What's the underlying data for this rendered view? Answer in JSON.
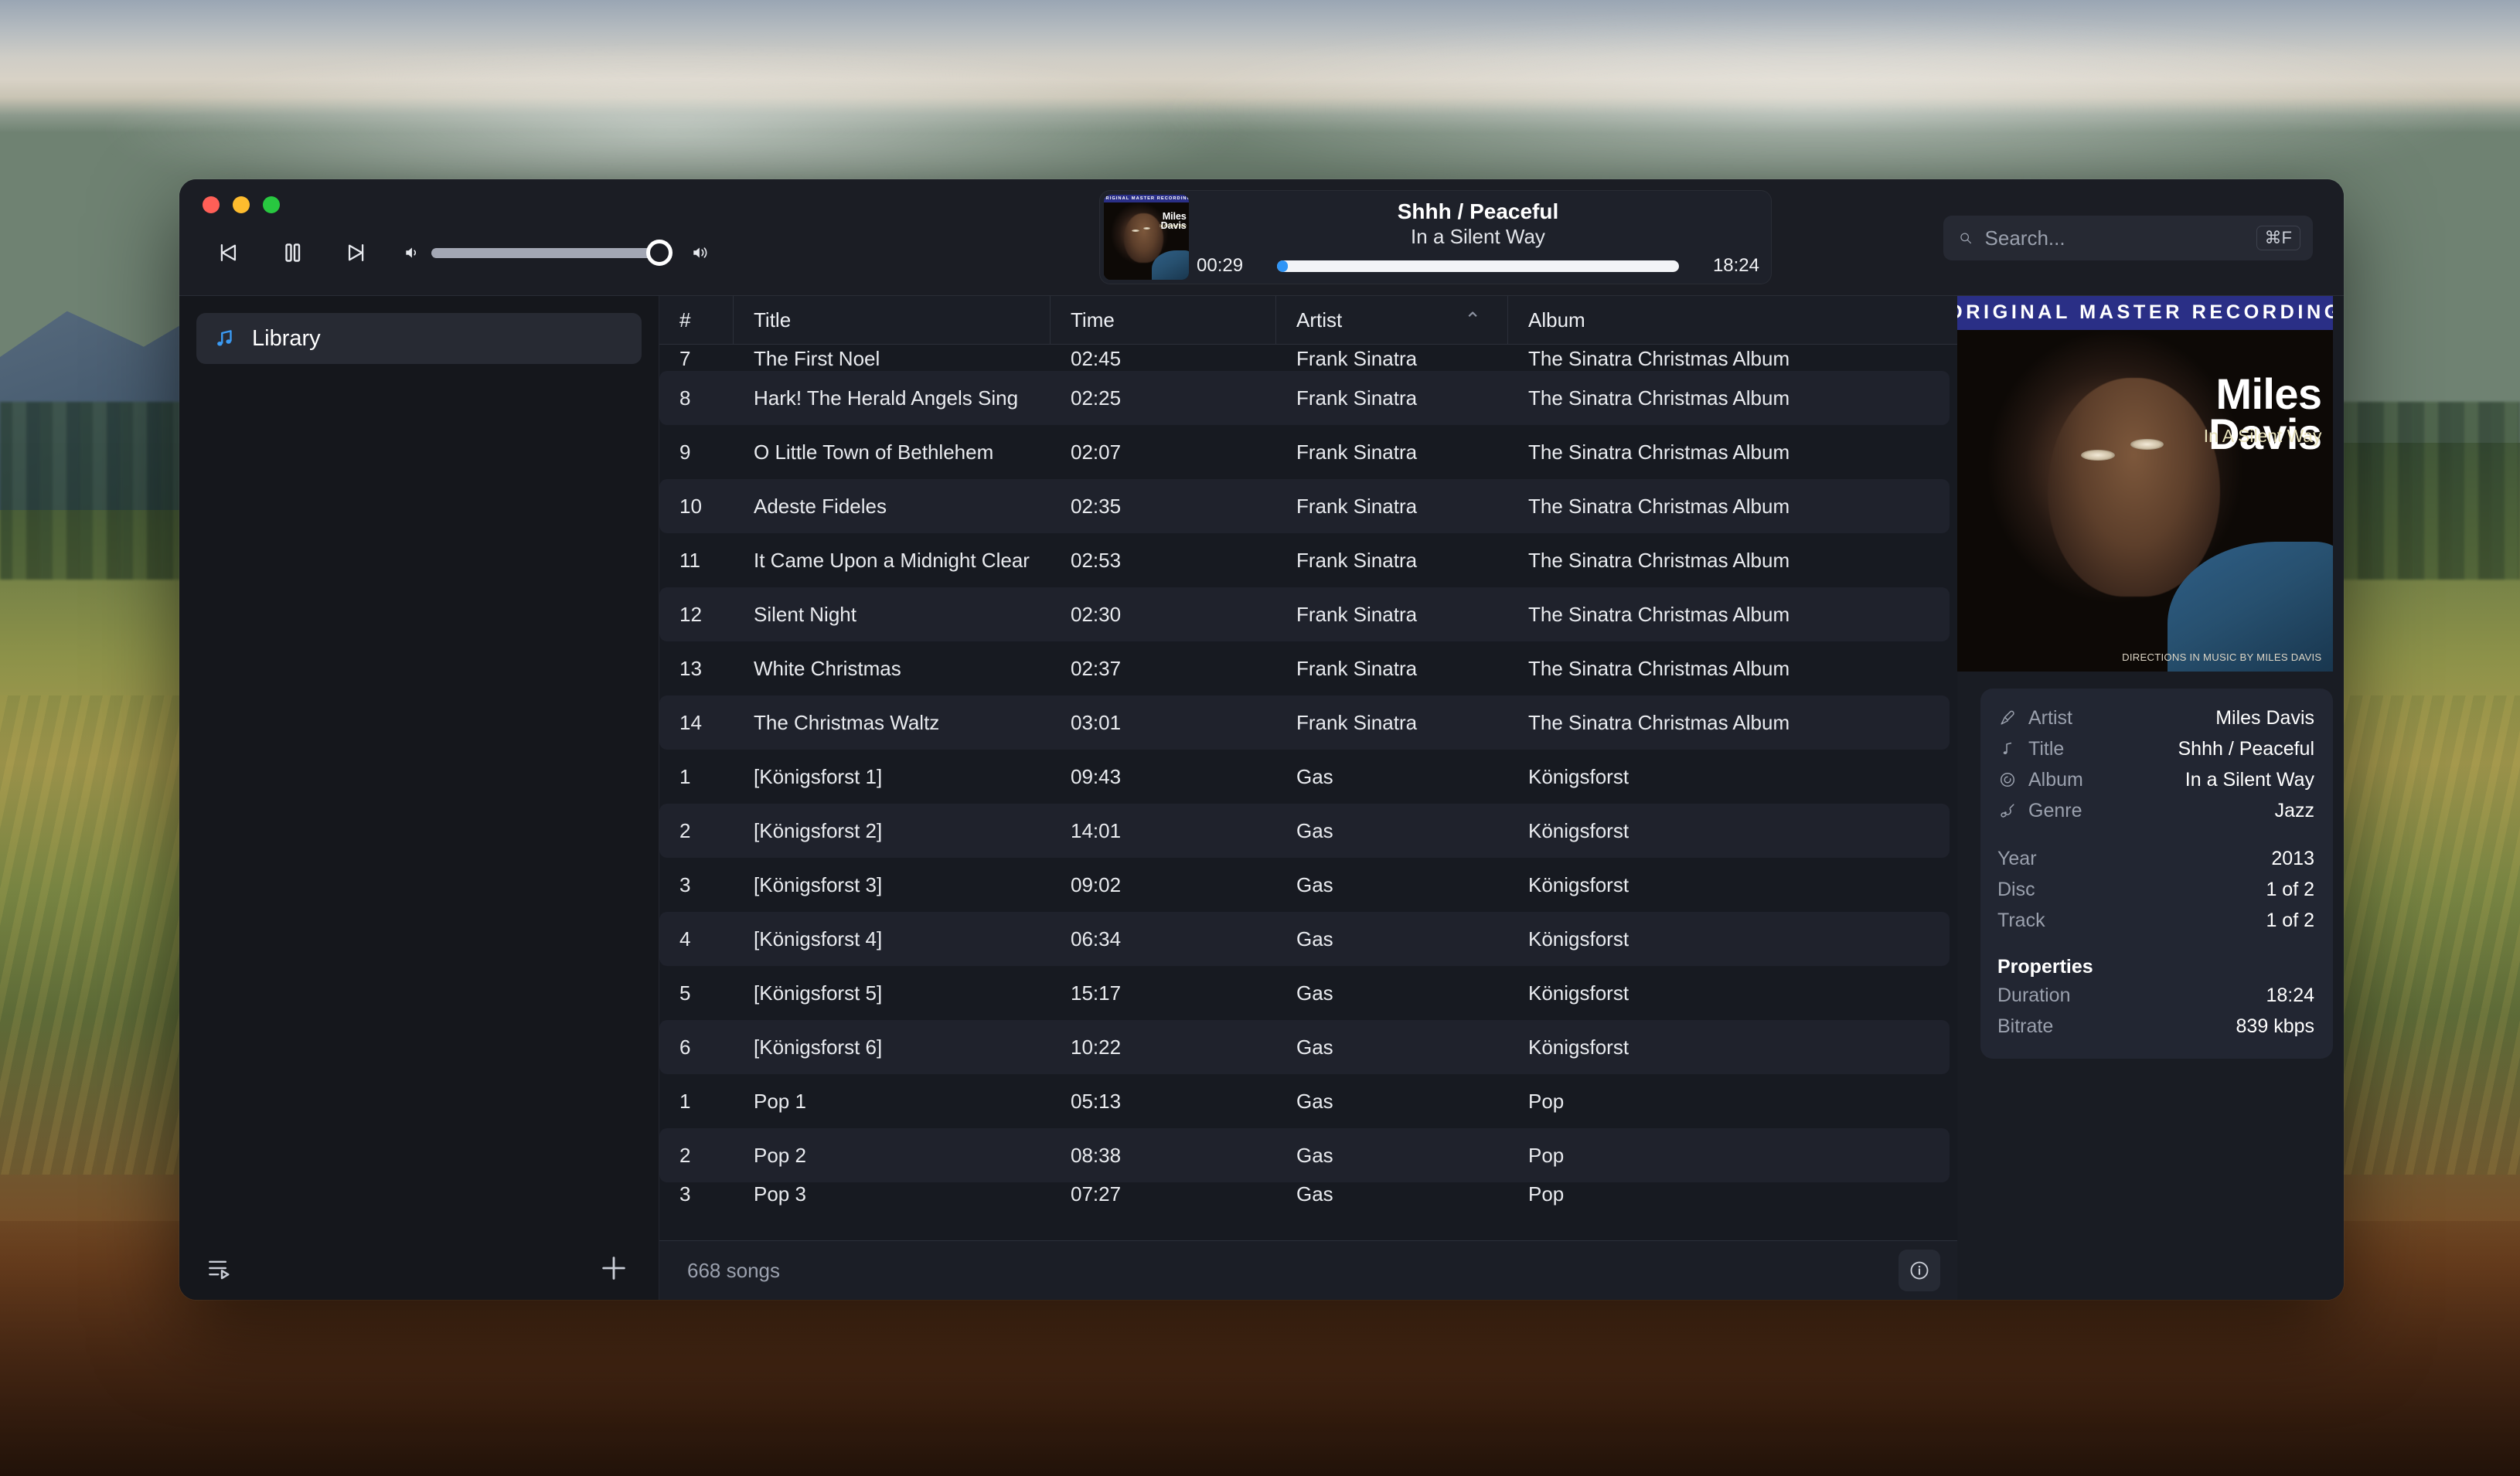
{
  "window": {
    "traffic_lights": [
      "close",
      "minimize",
      "maximize"
    ]
  },
  "player": {
    "previous_label": "Previous",
    "pause_label": "Pause",
    "next_label": "Next",
    "volume_percent": 100,
    "now_playing": {
      "title": "Shhh / Peaceful",
      "album": "In a Silent Way",
      "elapsed": "00:29",
      "remaining": "18:24",
      "progress_percent": 2.7
    }
  },
  "search": {
    "placeholder": "Search...",
    "value": "",
    "shortcut": "⌘F"
  },
  "album_art": {
    "banner": "ORIGINAL MASTER RECORDING",
    "artist_line1": "Miles",
    "artist_line2": "Davis",
    "album_title": "In A Silent Way",
    "credit": "DIRECTIONS IN MUSIC BY MILES DAVIS"
  },
  "sidebar": {
    "items": [
      {
        "label": "Library",
        "icon": "music-note-icon",
        "selected": true
      }
    ],
    "footer": {
      "queue_icon": "playlist-queue-icon",
      "add_icon": "plus-icon"
    }
  },
  "table": {
    "columns": [
      {
        "key": "num",
        "label": "#",
        "sorted": false
      },
      {
        "key": "title",
        "label": "Title",
        "sorted": false
      },
      {
        "key": "time",
        "label": "Time",
        "sorted": false
      },
      {
        "key": "artist",
        "label": "Artist",
        "sorted": true,
        "sort_direction": "ascending",
        "sort_glyph": "⌃"
      },
      {
        "key": "album",
        "label": "Album",
        "sorted": false
      }
    ],
    "rows": [
      {
        "num": "7",
        "title": "The First Noel",
        "time": "02:45",
        "artist": "Frank Sinatra",
        "album": "The Sinatra Christmas Album"
      },
      {
        "num": "8",
        "title": "Hark! The Herald Angels Sing",
        "time": "02:25",
        "artist": "Frank Sinatra",
        "album": "The Sinatra Christmas Album"
      },
      {
        "num": "9",
        "title": "O Little Town of Bethlehem",
        "time": "02:07",
        "artist": "Frank Sinatra",
        "album": "The Sinatra Christmas Album"
      },
      {
        "num": "10",
        "title": "Adeste Fideles",
        "time": "02:35",
        "artist": "Frank Sinatra",
        "album": "The Sinatra Christmas Album"
      },
      {
        "num": "11",
        "title": "It Came Upon a Midnight Clear",
        "time": "02:53",
        "artist": "Frank Sinatra",
        "album": "The Sinatra Christmas Album"
      },
      {
        "num": "12",
        "title": "Silent Night",
        "time": "02:30",
        "artist": "Frank Sinatra",
        "album": "The Sinatra Christmas Album"
      },
      {
        "num": "13",
        "title": "White Christmas",
        "time": "02:37",
        "artist": "Frank Sinatra",
        "album": "The Sinatra Christmas Album"
      },
      {
        "num": "14",
        "title": "The Christmas Waltz",
        "time": "03:01",
        "artist": "Frank Sinatra",
        "album": "The Sinatra Christmas Album"
      },
      {
        "num": "1",
        "title": "[Königsforst 1]",
        "time": "09:43",
        "artist": "Gas",
        "album": "Königsforst"
      },
      {
        "num": "2",
        "title": "[Königsforst 2]",
        "time": "14:01",
        "artist": "Gas",
        "album": "Königsforst"
      },
      {
        "num": "3",
        "title": "[Königsforst 3]",
        "time": "09:02",
        "artist": "Gas",
        "album": "Königsforst"
      },
      {
        "num": "4",
        "title": "[Königsforst 4]",
        "time": "06:34",
        "artist": "Gas",
        "album": "Königsforst"
      },
      {
        "num": "5",
        "title": "[Königsforst 5]",
        "time": "15:17",
        "artist": "Gas",
        "album": "Königsforst"
      },
      {
        "num": "6",
        "title": "[Königsforst 6]",
        "time": "10:22",
        "artist": "Gas",
        "album": "Königsforst"
      },
      {
        "num": "1",
        "title": "Pop 1",
        "time": "05:13",
        "artist": "Gas",
        "album": "Pop"
      },
      {
        "num": "2",
        "title": "Pop 2",
        "time": "08:38",
        "artist": "Gas",
        "album": "Pop"
      },
      {
        "num": "3",
        "title": "Pop 3",
        "time": "07:27",
        "artist": "Gas",
        "album": "Pop"
      }
    ]
  },
  "status": {
    "song_count": "668 songs",
    "info_icon": "info-circle-icon"
  },
  "info_panel": {
    "tags": [
      {
        "icon": "microphone-icon",
        "label": "Artist",
        "value": "Miles Davis"
      },
      {
        "icon": "music-note-icon",
        "label": "Title",
        "value": "Shhh / Peaceful"
      },
      {
        "icon": "disc-icon",
        "label": "Album",
        "value": "In a Silent Way"
      },
      {
        "icon": "guitar-icon",
        "label": "Genre",
        "value": "Jazz"
      }
    ],
    "numbers": [
      {
        "label": "Year",
        "value": "2013"
      },
      {
        "label": "Disc",
        "value": "1 of 2"
      },
      {
        "label": "Track",
        "value": "1 of 2"
      }
    ],
    "properties_heading": "Properties",
    "properties": [
      {
        "label": "Duration",
        "value": "18:24"
      },
      {
        "label": "Bitrate",
        "value": "839 kbps"
      }
    ]
  },
  "colors": {
    "accent": "#2f95f6",
    "window_bg": "#17191f",
    "titlebar_bg": "#1b1d24",
    "row_alt": "#1f222c",
    "panel_bg": "#222632",
    "muted_text": "#9aa0ad"
  }
}
